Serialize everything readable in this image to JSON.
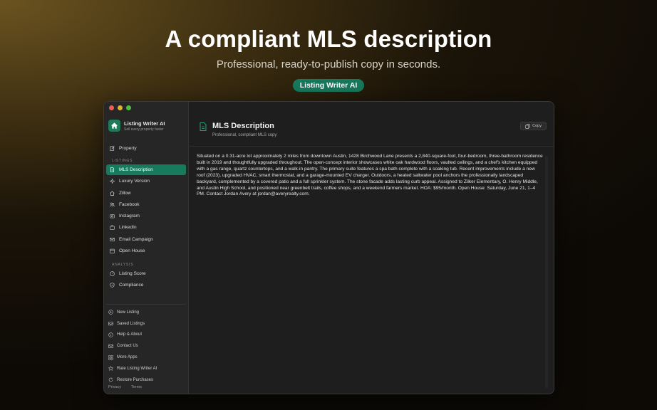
{
  "hero": {
    "title": "A compliant MLS description",
    "subtitle": "Professional, ready-to-publish copy in seconds.",
    "badge": "Listing Writer AI"
  },
  "app": {
    "name": "Listing Writer AI",
    "tagline": "Sell every property faster"
  },
  "sidebar": {
    "property": "Property",
    "listings_label": "LISTINGS",
    "listings": [
      {
        "label": "MLS Description",
        "icon": "document-icon",
        "active": true
      },
      {
        "label": "Luxury Version",
        "icon": "sparkle-icon"
      },
      {
        "label": "Zillow",
        "icon": "house-icon"
      },
      {
        "label": "Facebook",
        "icon": "people-icon"
      },
      {
        "label": "Instagram",
        "icon": "camera-icon"
      },
      {
        "label": "LinkedIn",
        "icon": "briefcase-icon"
      },
      {
        "label": "Email Campaign",
        "icon": "envelope-icon"
      },
      {
        "label": "Open House",
        "icon": "calendar-icon"
      }
    ],
    "analysis_label": "ANALYSIS",
    "analysis": [
      {
        "label": "Listing Score",
        "icon": "gauge-icon"
      },
      {
        "label": "Compliance",
        "icon": "shield-icon"
      }
    ],
    "bottom": [
      {
        "label": "New Listing",
        "icon": "plus-circle-icon"
      },
      {
        "label": "Saved Listings",
        "icon": "tray-icon"
      },
      {
        "label": "Help & About",
        "icon": "info-icon"
      },
      {
        "label": "Contact Us",
        "icon": "envelope-icon"
      },
      {
        "label": "More Apps",
        "icon": "grid-icon"
      },
      {
        "label": "Rate Listing Writer AI",
        "icon": "star-icon"
      },
      {
        "label": "Restore Purchases",
        "icon": "restore-icon"
      }
    ],
    "privacy": "Privacy",
    "terms": "Terms"
  },
  "main": {
    "title": "MLS Description",
    "subtitle": "Professional, compliant MLS copy",
    "copy_label": "Copy",
    "body": "Situated on a 0.31-acre lot approximately 2 miles from downtown Austin, 1428 Birchwood Lane presents a 2,840-square-foot, four-bedroom, three-bathroom residence built in 2019 and thoughtfully upgraded throughout. The open-concept interior showcases white oak hardwood floors, vaulted ceilings, and a chef's kitchen equipped with a gas range, quartz countertops, and a walk-in pantry. The primary suite features a spa bath complete with a soaking tub. Recent improvements include a new roof (2023), upgraded HVAC, smart thermostat, and a garage-mounted EV charger. Outdoors, a heated saltwater pool anchors the professionally landscaped backyard, complemented by a covered patio and a full sprinkler system. The stone facade adds lasting curb appeal. Assigned to Zilker Elementary, O. Henry Middle, and Austin High School, and positioned near greenbelt trails, coffee shops, and a weekend farmers market. HOA: $95/month. Open House: Saturday, June 21, 1–4 PM. Contact Jordan Avery at jordan@averyrealty.com."
  },
  "colors": {
    "accent": "#177a5c",
    "window_bg": "#1e1e1e",
    "sidebar_bg": "#262626"
  }
}
